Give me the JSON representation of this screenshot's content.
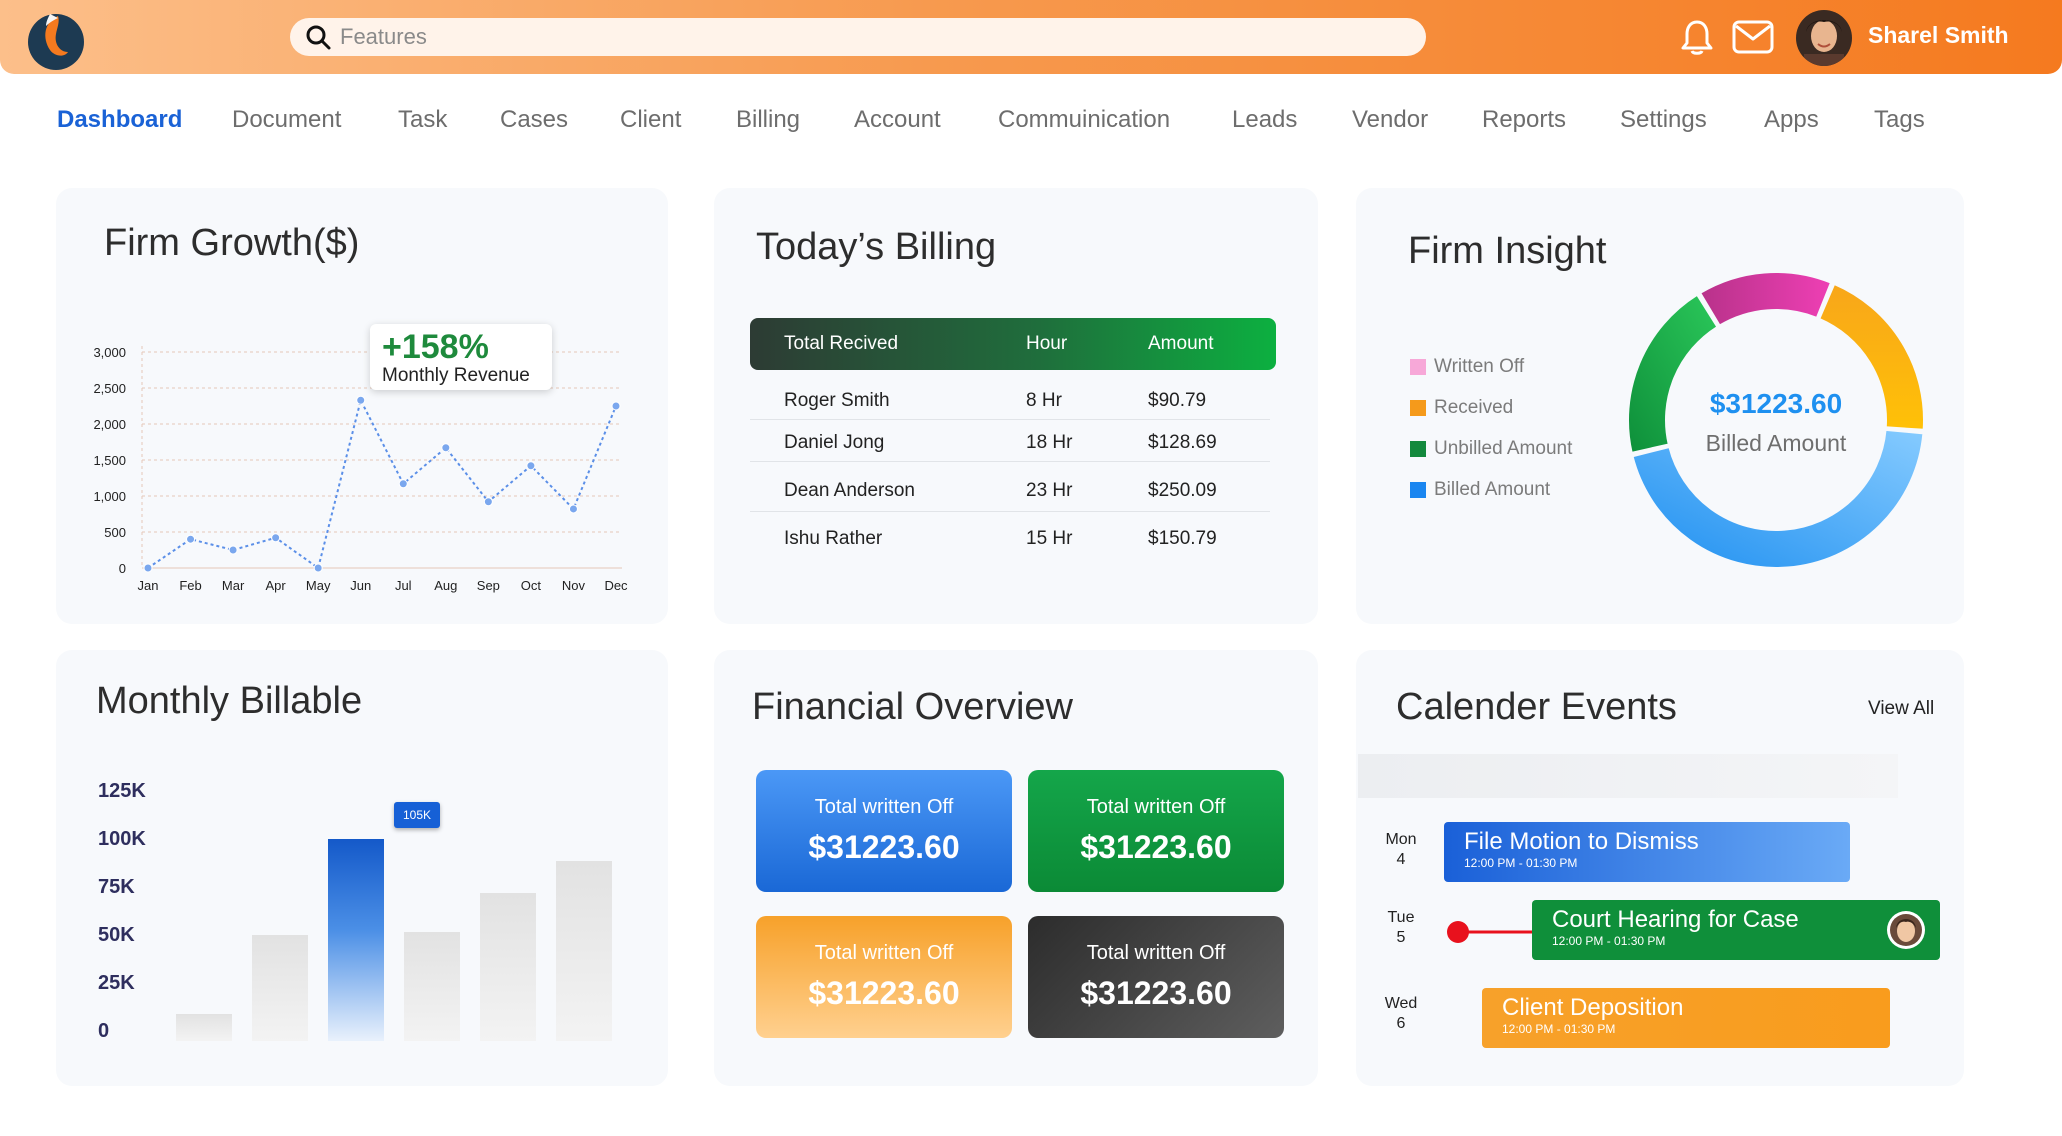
{
  "header": {
    "search_placeholder": "Features",
    "user_name": "Sharel Smith"
  },
  "nav": [
    {
      "label": "Dashboard",
      "active": true
    },
    {
      "label": "Document"
    },
    {
      "label": "Task"
    },
    {
      "label": "Cases"
    },
    {
      "label": "Client"
    },
    {
      "label": "Billing"
    },
    {
      "label": "Account"
    },
    {
      "label": "Commuinication"
    },
    {
      "label": "Leads"
    },
    {
      "label": "Vendor"
    },
    {
      "label": "Reports"
    },
    {
      "label": "Settings"
    },
    {
      "label": "Apps"
    },
    {
      "label": "Tags"
    }
  ],
  "growth": {
    "title": "Firm Growth($)",
    "badge_value": "+158%",
    "badge_label": "Monthly Revenue"
  },
  "billing": {
    "title": "Today’s Billing",
    "columns": [
      "Total Recived",
      "Hour",
      "Amount"
    ],
    "rows": [
      {
        "name": "Roger Smith",
        "hour": "8 Hr",
        "amount": "$90.79"
      },
      {
        "name": "Daniel Jong",
        "hour": "18 Hr",
        "amount": "$128.69"
      },
      {
        "name": "Dean Anderson",
        "hour": "23 Hr",
        "amount": "$250.09"
      },
      {
        "name": "Ishu Rather",
        "hour": "15 Hr",
        "amount": "$150.79"
      }
    ]
  },
  "insight": {
    "title": "Firm Insight",
    "legend": [
      {
        "label": "Written Off",
        "color": "#f7a8d8"
      },
      {
        "label": "Received",
        "color": "#f59a1b"
      },
      {
        "label": "Unbilled Amount",
        "color": "#13893d"
      },
      {
        "label": "Billed Amount",
        "color": "#1a86f0"
      }
    ],
    "center_value": "$31223.60",
    "center_label": "Billed Amount"
  },
  "monthly": {
    "title": "Monthly Billable",
    "highlight_label": "105K"
  },
  "financial": {
    "title": "Financial Overview",
    "boxes": [
      {
        "label": "Total written Off",
        "value": "$31223.60",
        "color": "#2a7de6"
      },
      {
        "label": "Total written Off",
        "value": "$31223.60",
        "color": "#12963f"
      },
      {
        "label": "Total written Off",
        "value": "$31223.60",
        "color": "#f8a630"
      },
      {
        "label": "Total written Off",
        "value": "$31223.60",
        "color": "#3d3d3d"
      }
    ]
  },
  "calendar": {
    "title": "Calender Events",
    "view_all": "View All",
    "days": [
      {
        "name": "Mon",
        "num": "4"
      },
      {
        "name": "Tue",
        "num": "5"
      },
      {
        "name": "Wed",
        "num": "6"
      }
    ],
    "events": [
      {
        "title": "File Motion to Dismiss",
        "time": "12:00 PM - 01:30 PM",
        "color": "#1a6fe0"
      },
      {
        "title": "Court Hearing for Case",
        "time": "12:00 PM - 01:30 PM",
        "color": "#12963f"
      },
      {
        "title": "Client Deposition",
        "time": "12:00 PM - 01:30 PM",
        "color": "#f8a12a"
      }
    ]
  },
  "chart_data": [
    {
      "type": "line",
      "title": "Firm Growth($)",
      "categories": [
        "Jan",
        "Feb",
        "Mar",
        "Apr",
        "May",
        "Jun",
        "Jul",
        "Aug",
        "Sep",
        "Oct",
        "Nov",
        "Dec"
      ],
      "values": [
        0,
        400,
        250,
        420,
        0,
        2330,
        1170,
        1670,
        920,
        1420,
        820,
        2250
      ],
      "yticks": [
        "0",
        "500",
        "1,000",
        "1,500",
        "2,000",
        "2,500",
        "3,000"
      ],
      "ylim": [
        0,
        3000
      ],
      "color": "#5b8fe8"
    },
    {
      "type": "bar",
      "title": "Monthly Billable",
      "values": [
        14,
        55,
        105,
        57,
        77,
        94
      ],
      "highlight_index": 2,
      "yticks": [
        "125K",
        "100K",
        "75K",
        "50K",
        "25K",
        "0"
      ],
      "ylim": [
        0,
        125
      ]
    },
    {
      "type": "pie",
      "title": "Firm Insight",
      "slices": [
        {
          "label": "Written Off",
          "value": 15
        },
        {
          "label": "Received",
          "value": 20
        },
        {
          "label": "Billed Amount",
          "value": 45
        },
        {
          "label": "Unbilled Amount",
          "value": 20
        }
      ]
    }
  ]
}
